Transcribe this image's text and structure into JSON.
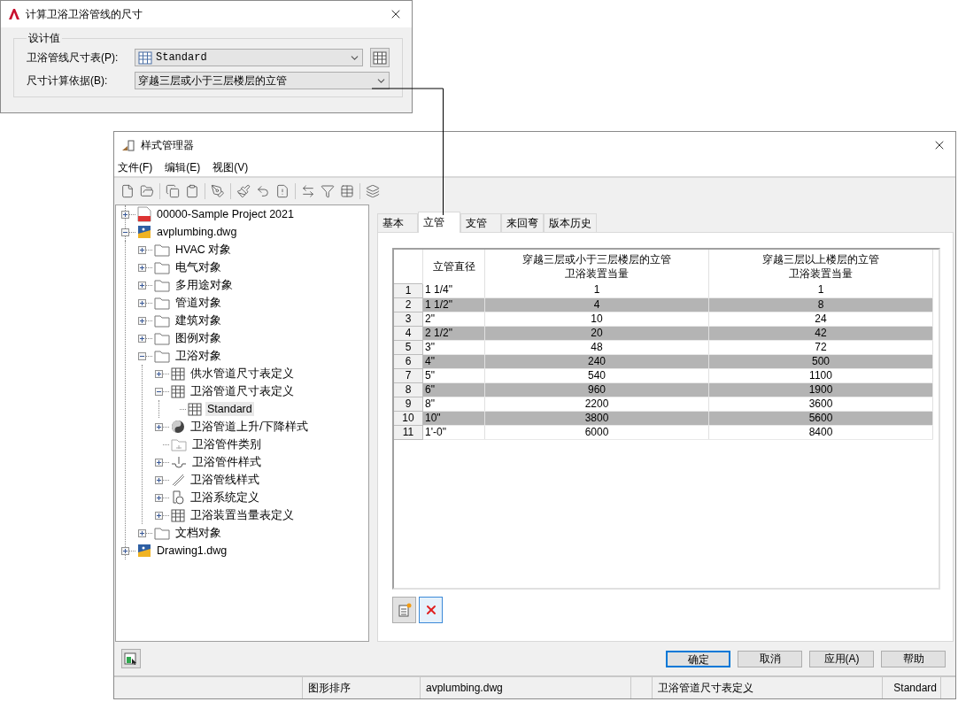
{
  "calc_dialog": {
    "title": "计算卫浴卫浴管线的尺寸",
    "group": {
      "title": "设计值",
      "fields": [
        {
          "label": "卫浴管线尺寸表(P):",
          "value": "Standard",
          "kind": "table-combo"
        },
        {
          "label": "尺寸计算依据(B):",
          "value": "穿越三层或小于三层楼层的立管",
          "kind": "combo"
        }
      ]
    }
  },
  "style_manager": {
    "title": "样式管理器",
    "menu": [
      "文件(F)",
      "编辑(E)",
      "视图(V)"
    ],
    "tree": [
      {
        "label": "00000-Sample Project 2021",
        "kind": "project",
        "expanded": false,
        "selected": false
      },
      {
        "label": "avplumbing.dwg",
        "kind": "drawing",
        "expanded": true,
        "selected": false,
        "children": [
          {
            "label": "HVAC 对象",
            "kind": "folder",
            "expanded": false,
            "selected": false
          },
          {
            "label": "电气对象",
            "kind": "folder",
            "expanded": false,
            "selected": false
          },
          {
            "label": "多用途对象",
            "kind": "folder",
            "expanded": false,
            "selected": false
          },
          {
            "label": "管道对象",
            "kind": "folder",
            "expanded": false,
            "selected": false
          },
          {
            "label": "建筑对象",
            "kind": "folder",
            "expanded": false,
            "selected": false
          },
          {
            "label": "图例对象",
            "kind": "folder",
            "expanded": false,
            "selected": false
          },
          {
            "label": "卫浴对象",
            "kind": "folder",
            "expanded": true,
            "selected": false,
            "children": [
              {
                "label": "供水管道尺寸表定义",
                "kind": "table",
                "expanded": false,
                "selected": false
              },
              {
                "label": "卫浴管道尺寸表定义",
                "kind": "table",
                "expanded": true,
                "selected": false,
                "children": [
                  {
                    "label": "Standard",
                    "kind": "table",
                    "selected": true
                  }
                ]
              },
              {
                "label": "卫浴管道上升/下降样式",
                "kind": "riser",
                "expanded": false,
                "selected": false
              },
              {
                "label": "卫浴管件类别",
                "kind": "category",
                "selected": false
              },
              {
                "label": "卫浴管件样式",
                "kind": "fitting",
                "expanded": false,
                "selected": false
              },
              {
                "label": "卫浴管线样式",
                "kind": "pipe",
                "expanded": false,
                "selected": false
              },
              {
                "label": "卫浴系统定义",
                "kind": "system",
                "expanded": false,
                "selected": false
              },
              {
                "label": "卫浴装置当量表定义",
                "kind": "table",
                "expanded": false,
                "selected": false
              }
            ]
          },
          {
            "label": "文档对象",
            "kind": "folder",
            "expanded": false,
            "selected": false
          }
        ]
      },
      {
        "label": "Drawing1.dwg",
        "kind": "drawing",
        "expanded": false,
        "selected": false
      }
    ],
    "tabs": [
      {
        "label": "基本",
        "selected": false
      },
      {
        "label": "立管",
        "selected": true
      },
      {
        "label": "支管",
        "selected": false
      },
      {
        "label": "来回弯",
        "selected": false
      },
      {
        "label": "版本历史",
        "selected": false
      }
    ],
    "table": {
      "columns": [
        {
          "lines": [
            "立管直径"
          ]
        },
        {
          "lines": [
            "穿越三层或小于三层楼层的立管",
            "卫浴装置当量"
          ]
        },
        {
          "lines": [
            "穿越三层以上楼层的立管",
            "卫浴装置当量"
          ]
        }
      ],
      "rows": [
        {
          "index": "1",
          "cells": [
            "1 1/4\"",
            "1",
            "1"
          ]
        },
        {
          "index": "2",
          "cells": [
            "1 1/2\"",
            "4",
            "8"
          ]
        },
        {
          "index": "3",
          "cells": [
            "2\"",
            "10",
            "24"
          ]
        },
        {
          "index": "4",
          "cells": [
            "2 1/2\"",
            "20",
            "42"
          ]
        },
        {
          "index": "5",
          "cells": [
            "3\"",
            "48",
            "72"
          ]
        },
        {
          "index": "6",
          "cells": [
            "4\"",
            "240",
            "500"
          ]
        },
        {
          "index": "7",
          "cells": [
            "5\"",
            "540",
            "1100"
          ]
        },
        {
          "index": "8",
          "cells": [
            "6\"",
            "960",
            "1900"
          ]
        },
        {
          "index": "9",
          "cells": [
            "8\"",
            "2200",
            "3600"
          ]
        },
        {
          "index": "10",
          "cells": [
            "10\"",
            "3800",
            "5600"
          ]
        },
        {
          "index": "11",
          "cells": [
            "1'-0\"",
            "6000",
            "8400"
          ]
        }
      ]
    },
    "buttons": [
      {
        "label": "确定",
        "default": true
      },
      {
        "label": "取消",
        "default": false
      },
      {
        "label": "应用(A)",
        "default": false
      },
      {
        "label": "帮助",
        "default": false
      }
    ],
    "status_bar": [
      {
        "text": "图形排序"
      },
      {
        "text": "avplumbing.dwg"
      },
      {
        "text": "卫浴管道尺寸表定义"
      },
      {
        "text": "Standard"
      }
    ]
  }
}
